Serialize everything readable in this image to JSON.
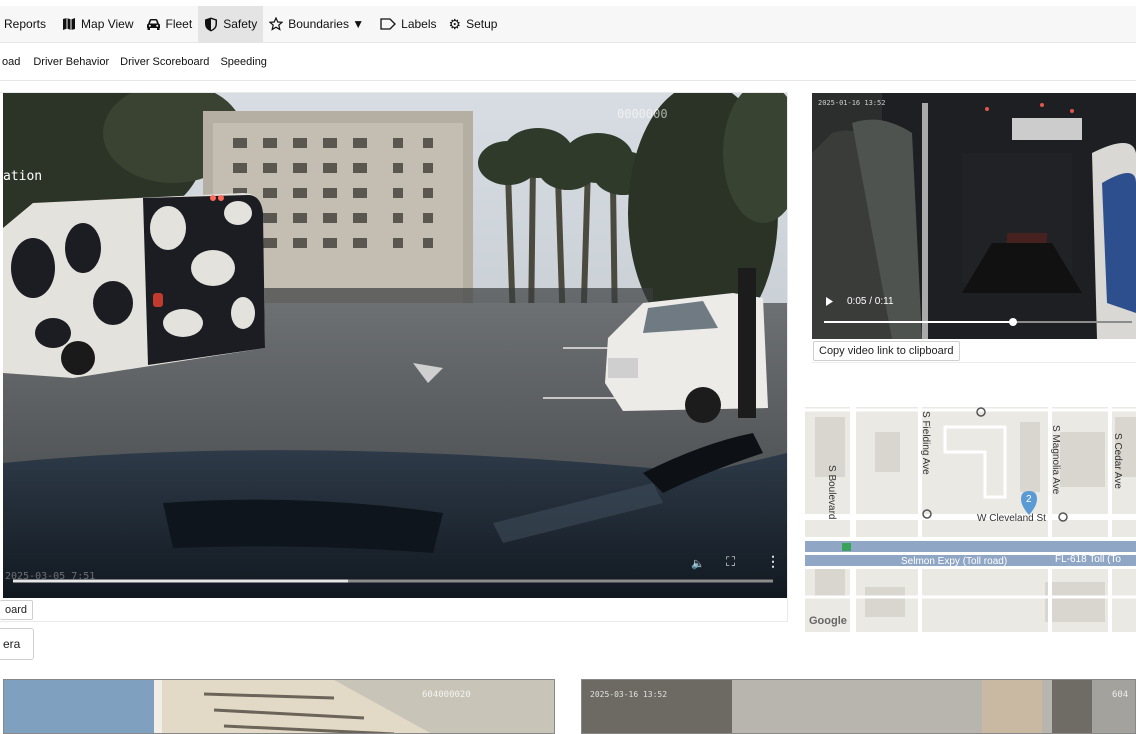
{
  "topnav": {
    "items": [
      {
        "label": "Reports",
        "icon": "none"
      },
      {
        "label": "Map View",
        "icon": "map-icon"
      },
      {
        "label": "Fleet",
        "icon": "car-icon"
      },
      {
        "label": "Safety",
        "icon": "shield-icon",
        "active": true
      },
      {
        "label": "Boundaries ▼",
        "icon": "star-icon"
      },
      {
        "label": "Labels",
        "icon": "tag-icon"
      },
      {
        "label": "Setup",
        "icon": "gear-icon"
      }
    ]
  },
  "subnav": {
    "items": [
      "oad",
      "Driver Behavior",
      "Driver Scoreboard",
      "Speeding"
    ]
  },
  "main_video": {
    "overlay_left": "ation",
    "overlay_top": "0000000",
    "overlay_bottom": "2025-03-05 7:51",
    "progress": 0.44,
    "copy_label": "oard",
    "camera_label": "era"
  },
  "side_video": {
    "timestamp": "2025-01-16 13:52",
    "time_display": "0:05 / 0:11",
    "progress": 0.55,
    "copy_label": "Copy video link to clipboard"
  },
  "map": {
    "streets": {
      "boulevard": "S Boulevard",
      "fielding": "S Fielding Ave",
      "magnolia": "S Magnolia Ave",
      "cedar": "S Cedar Ave",
      "cleveland": "W Cleveland St",
      "selmon": "Selmon Expy (Toll road)",
      "fl618": "FL-618 Toll (To"
    },
    "marker_label": "2",
    "brand": "Google",
    "colors": {
      "road": "#ffffff",
      "highway": "#8fa6c4",
      "marker": "#5b9bd5"
    }
  },
  "bottom_videos": {
    "left_id": "604000020",
    "right_stamp": "2025-03-16 13:52",
    "right_id": "604"
  }
}
